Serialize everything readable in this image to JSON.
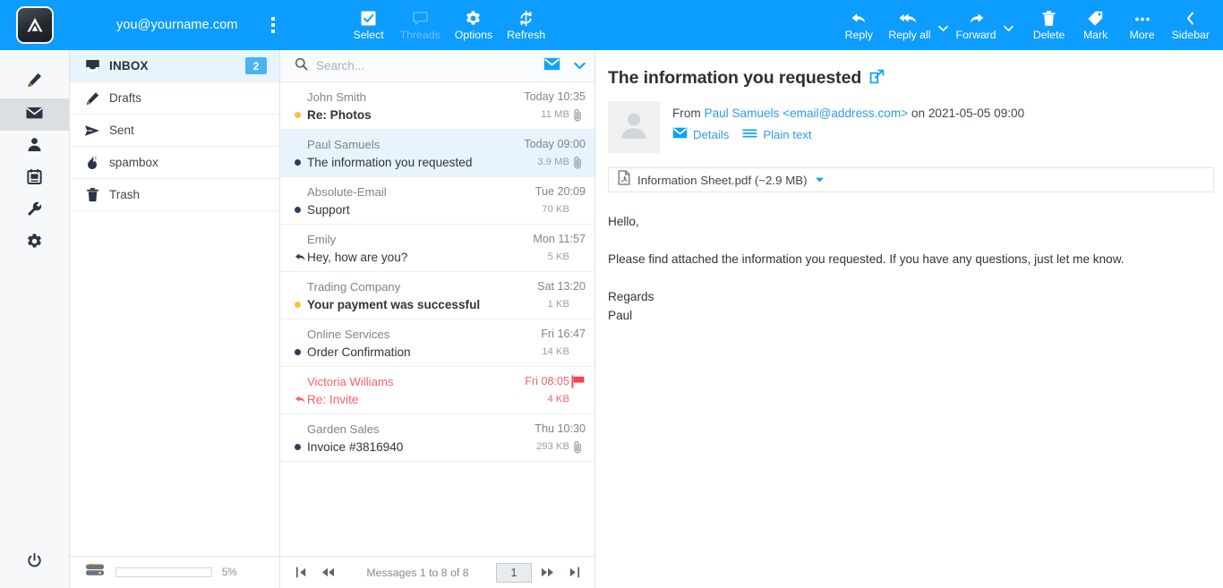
{
  "header": {
    "logo_icon": "app-logo-triangle",
    "account_email": "you@yourname.com",
    "menu_icon": "kebab-menu-icon",
    "center_buttons": [
      {
        "label": "Select",
        "icon": "checkbox-checked-icon",
        "disabled": false
      },
      {
        "label": "Threads",
        "icon": "speech-bubble-icon",
        "disabled": true
      },
      {
        "label": "Options",
        "icon": "gear-icon",
        "disabled": false
      },
      {
        "label": "Refresh",
        "icon": "refresh-icon",
        "disabled": false
      }
    ],
    "right_buttons": [
      {
        "label": "Reply",
        "icon": "reply-arrow-icon",
        "caret": false
      },
      {
        "label": "Reply all",
        "icon": "reply-all-arrow-icon",
        "caret": true
      },
      {
        "label": "Forward",
        "icon": "forward-arrow-icon",
        "caret": true
      },
      {
        "label": "Delete",
        "icon": "trash-icon",
        "caret": false
      },
      {
        "label": "Mark",
        "icon": "tag-icon",
        "caret": false
      },
      {
        "label": "More",
        "icon": "ellipsis-horizontal-icon",
        "caret": false
      },
      {
        "label": "Sidebar",
        "icon": "chevron-left-icon",
        "caret": false
      }
    ]
  },
  "rail": {
    "items": [
      {
        "name": "compose",
        "icon": "pencil-icon",
        "active": false
      },
      {
        "name": "mail",
        "icon": "envelope-icon",
        "active": true
      },
      {
        "name": "contacts",
        "icon": "person-icon",
        "active": false
      },
      {
        "name": "tasks",
        "icon": "notes-icon",
        "active": false
      },
      {
        "name": "tools",
        "icon": "wrench-icon",
        "active": false
      },
      {
        "name": "settings",
        "icon": "gear-icon",
        "active": false
      }
    ],
    "power_icon": "power-icon"
  },
  "folders": {
    "items": [
      {
        "label": "INBOX",
        "icon": "inbox-icon",
        "badge": "2",
        "selected": true
      },
      {
        "label": "Drafts",
        "icon": "pencil-icon",
        "badge": "",
        "selected": false
      },
      {
        "label": "Sent",
        "icon": "send-icon",
        "badge": "",
        "selected": false
      },
      {
        "label": "spambox",
        "icon": "flame-icon",
        "badge": "",
        "selected": false
      },
      {
        "label": "Trash",
        "icon": "trash-icon",
        "badge": "",
        "selected": false
      }
    ],
    "quota": {
      "icon": "disk-icon",
      "percent_label": "5%",
      "percent_value": 5,
      "fill_color": "#4db8f5"
    }
  },
  "messagelist": {
    "search": {
      "icon": "search-icon",
      "placeholder": "Search...",
      "value": "",
      "scope_icon": "envelope-filled-icon",
      "dropdown_icon": "chevron-down-icon"
    },
    "rows": [
      {
        "from": "John Smith",
        "date": "Today 10:35",
        "subject": "Re: Photos",
        "size": "11 MB",
        "state": "dot-amber",
        "unread": true,
        "attachment": true,
        "flagged": false,
        "selected": false
      },
      {
        "from": "Paul Samuels",
        "date": "Today 09:00",
        "subject": "The information you requested",
        "size": "3.9 MB",
        "state": "dot-dark",
        "unread": false,
        "attachment": true,
        "flagged": false,
        "selected": true
      },
      {
        "from": "Absolute-Email",
        "date": "Tue 20:09",
        "subject": "Support",
        "size": "70 KB",
        "state": "dot-dark",
        "unread": false,
        "attachment": false,
        "flagged": false,
        "selected": false
      },
      {
        "from": "Emily",
        "date": "Mon 11:57",
        "subject": "Hey, how are you?",
        "size": "5 KB",
        "state": "replied",
        "unread": false,
        "attachment": false,
        "flagged": false,
        "selected": false
      },
      {
        "from": "Trading Company",
        "date": "Sat 13:20",
        "subject": "Your payment was successful",
        "size": "1 KB",
        "state": "dot-amber",
        "unread": true,
        "attachment": false,
        "flagged": false,
        "selected": false
      },
      {
        "from": "Online Services",
        "date": "Fri 16:47",
        "subject": "Order Confirmation",
        "size": "14 KB",
        "state": "dot-dark",
        "unread": false,
        "attachment": false,
        "flagged": false,
        "selected": false
      },
      {
        "from": "Victoria Williams",
        "date": "Fri 08:05",
        "subject": "Re: Invite",
        "size": "4 KB",
        "state": "replied",
        "unread": false,
        "attachment": false,
        "flagged": true,
        "selected": false
      },
      {
        "from": "Garden Sales",
        "date": "Thu 10:30",
        "subject": "Invoice #3816940",
        "size": "293 KB",
        "state": "dot-dark",
        "unread": false,
        "attachment": true,
        "flagged": false,
        "selected": false
      }
    ],
    "footer": {
      "first_icon": "page-first-icon",
      "prev_icon": "page-prev-icon",
      "status": "Messages 1 to 8 of 8",
      "page_value": "1",
      "next_icon": "page-next-icon",
      "last_icon": "page-last-icon"
    }
  },
  "reader": {
    "subject": "The information you requested",
    "open_external_icon": "open-in-new-window-icon",
    "avatar_icon": "person-placeholder-icon",
    "from_prefix": "From",
    "sender_name": "Paul Samuels <email@address.com>",
    "date_prefix": "on",
    "date": "2021-05-05 09:00",
    "details_label": "Details",
    "details_icon": "envelope-filled-icon",
    "plaintext_label": "Plain text",
    "plaintext_icon": "lines-icon",
    "attachment": {
      "icon": "pdf-file-icon",
      "name": "Information Sheet.pdf (~2.9 MB)",
      "dropdown_icon": "caret-down-icon"
    },
    "body": {
      "greeting": "Hello,",
      "paragraph": "Please find attached the information you requested. If you have any questions, just let me know.",
      "signoff": "Regards",
      "signature": "Paul"
    }
  },
  "colors": {
    "brand_blue": "#0d9cff",
    "link_blue": "#2e9bf0",
    "selected_row": "#e7f4fd",
    "flag_red": "#f9606b",
    "unread_amber": "#f5c13f",
    "state_dark": "#2c3e60"
  }
}
